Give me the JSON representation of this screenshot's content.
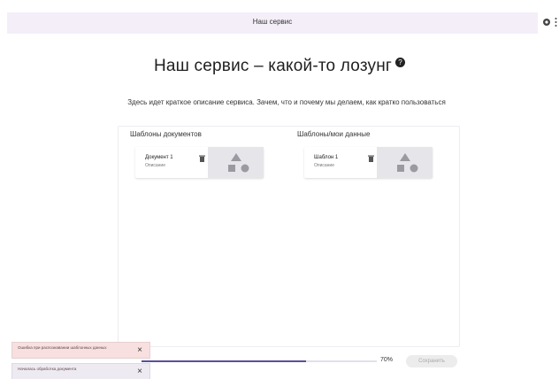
{
  "header": {
    "title": "Наш сервис"
  },
  "hero": {
    "title": "Наш сервис – какой-то лозунг",
    "help_glyph": "?",
    "description": "Здесь идет краткое описание сервиса. Зачем, что и почему мы делаем, как кратко пользоваться"
  },
  "columns": [
    {
      "heading": "Шаблоны документов",
      "cards": [
        {
          "title": "Документ 1",
          "subtitle": "Описание"
        }
      ]
    },
    {
      "heading": "Шаблоны/мои данные",
      "cards": [
        {
          "title": "Шаблон 1",
          "subtitle": "Описание"
        }
      ]
    }
  ],
  "progress": {
    "fraction": 0.7,
    "label": "70%"
  },
  "continue_button": {
    "label": "Сохранить"
  },
  "toasts": [
    {
      "text": "Ошибка при распознавании шаблонных данных",
      "close": "×"
    },
    {
      "text": "Началась обработка документа",
      "close": "×"
    }
  ],
  "colors": {
    "accent": "#5b4f9a",
    "header_bg": "#f3eef8",
    "error_toast_bg": "#f8e0e0"
  }
}
